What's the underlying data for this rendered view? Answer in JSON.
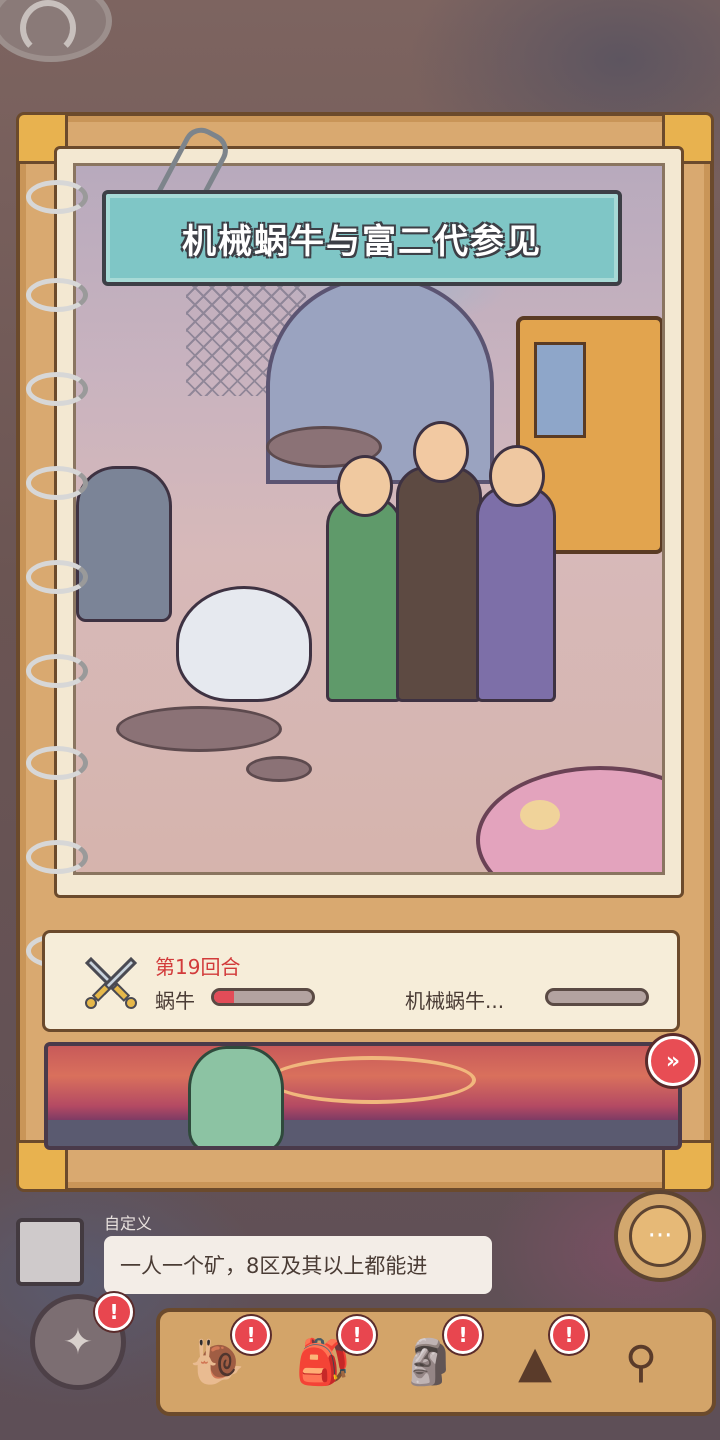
{
  "event": {
    "title": "机械蜗牛与富二代参见"
  },
  "battle": {
    "round_label": "第19回合",
    "player_name": "蜗牛",
    "player_hp": 0.2,
    "enemy_name": "机械蜗牛...",
    "enemy_hp": 0.0,
    "skip_icon": "fast-forward-icon"
  },
  "chat": {
    "channel_tag": "自定义",
    "message": "一人一个矿，8区及其以上都能进",
    "open_icon": "chat-bubble-icon"
  },
  "nav": {
    "items": [
      {
        "name": "snail",
        "icon": "snail-icon",
        "badge": "!"
      },
      {
        "name": "backpack",
        "icon": "backpack-icon",
        "badge": "!"
      },
      {
        "name": "bust",
        "icon": "bust-statue-icon",
        "badge": "!"
      },
      {
        "name": "pyramid",
        "icon": "pyramid-eye-icon",
        "badge": "!"
      },
      {
        "name": "search",
        "icon": "magnifier-icon",
        "badge": ""
      }
    ],
    "compass_badge": "!"
  },
  "colors": {
    "title_banner": "#7fc6c6",
    "round_text": "#d23a3a",
    "hp_fill": "#e24c58",
    "badge": "#e8464f"
  }
}
